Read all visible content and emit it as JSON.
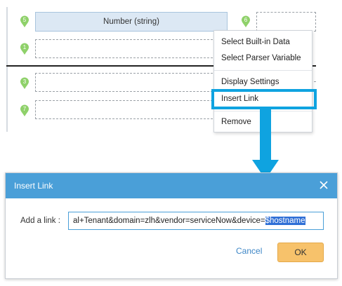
{
  "canvas": {
    "pins": [
      "5",
      "6",
      "1",
      "3",
      "7"
    ],
    "number_field_label": "Number (string)"
  },
  "context_menu": {
    "items": [
      "Select Built-in Data",
      "Select Parser Variable",
      "Display Settings",
      "Insert Link",
      "Remove"
    ]
  },
  "dialog": {
    "title": "Insert Link",
    "link_label": "Add a link :",
    "link_value_prefix": "al+Tenant&domain=zlh&vendor=serviceNow&device=",
    "link_value_selected": "$hostname",
    "cancel_label": "Cancel",
    "ok_label": "OK"
  },
  "colors": {
    "pin": "#8fd16a",
    "dialog_header": "#4a9fd8",
    "highlight": "#0fa3e0",
    "ok_button": "#f7c26b",
    "selection": "#2f6fd6"
  },
  "icons": {
    "close": "close-icon",
    "pin": "location-pin-icon",
    "arrow": "down-arrow-icon"
  }
}
